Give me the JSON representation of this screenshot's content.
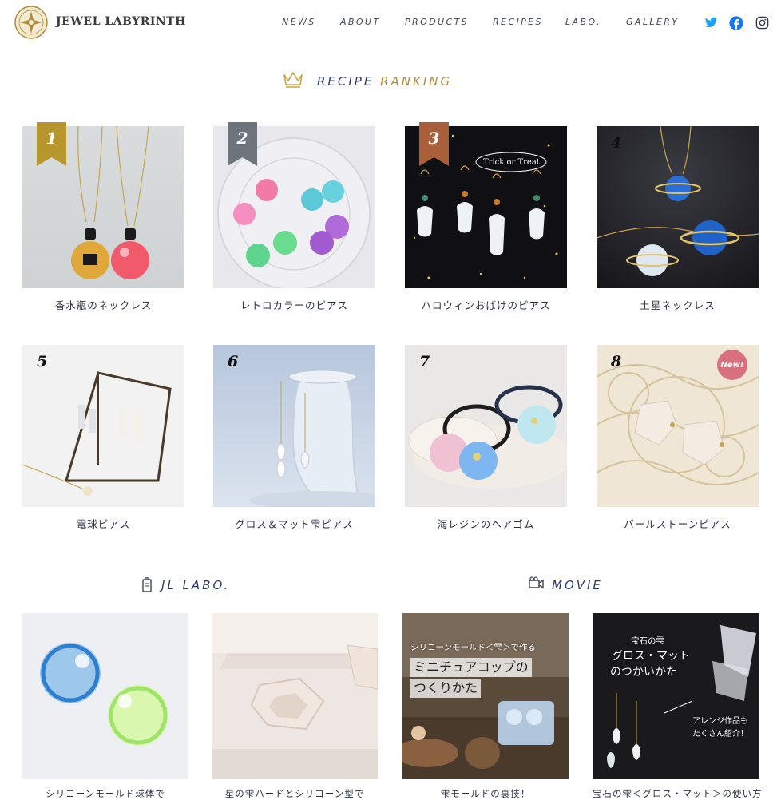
{
  "header": {
    "brand": "JEWEL LABYRINTH",
    "nav": [
      "NEWS",
      "ABOUT",
      "PRODUCTS",
      "RECIPES",
      "LABO.",
      "GALLERY"
    ],
    "social": [
      "twitter-icon",
      "facebook-icon",
      "instagram-icon"
    ]
  },
  "ranking": {
    "title_a": "RECIPE",
    "title_b": "RANKING",
    "items": [
      {
        "rank": "1",
        "label": "香水瓶のネックレス"
      },
      {
        "rank": "2",
        "label": "レトロカラーのピアス"
      },
      {
        "rank": "3",
        "label": "ハロウィンおばけのピアス"
      },
      {
        "rank": "4",
        "label": "土星ネックレス"
      },
      {
        "rank": "5",
        "label": "電球ピアス"
      },
      {
        "rank": "6",
        "label": "グロス＆マット雫ピアス"
      },
      {
        "rank": "7",
        "label": "海レジンのヘアゴム"
      },
      {
        "rank": "8",
        "label": "パールストーンピアス"
      }
    ],
    "new_badge": "New!",
    "halloween_sign": "Trick or Treat"
  },
  "labo": {
    "title": "JL LABO.",
    "items": [
      {
        "label": "シリコーンモールド球体で"
      },
      {
        "label": "星の雫ハードとシリコーン型で"
      }
    ]
  },
  "movie": {
    "title": "MOVIE",
    "items": [
      {
        "label": "雫モールドの裏技！",
        "overlay": [
          "シリコーンモールド＜雫＞で作る",
          "ミニチュアコップの",
          "つくりかた"
        ]
      },
      {
        "label": "宝石の雫＜グロス・マット＞の使い方",
        "overlay": [
          "宝石の雫",
          "グロス・マット",
          "のつかいかた",
          "アレンジ作品も",
          "たくさん紹介！"
        ]
      }
    ]
  },
  "colors": {
    "navy": "#2b3a6b",
    "gold": "#b08d3a",
    "rank1": "#b8962e",
    "rank2": "#6e737c",
    "rank3": "#a9603a",
    "new": "#d9707d"
  }
}
